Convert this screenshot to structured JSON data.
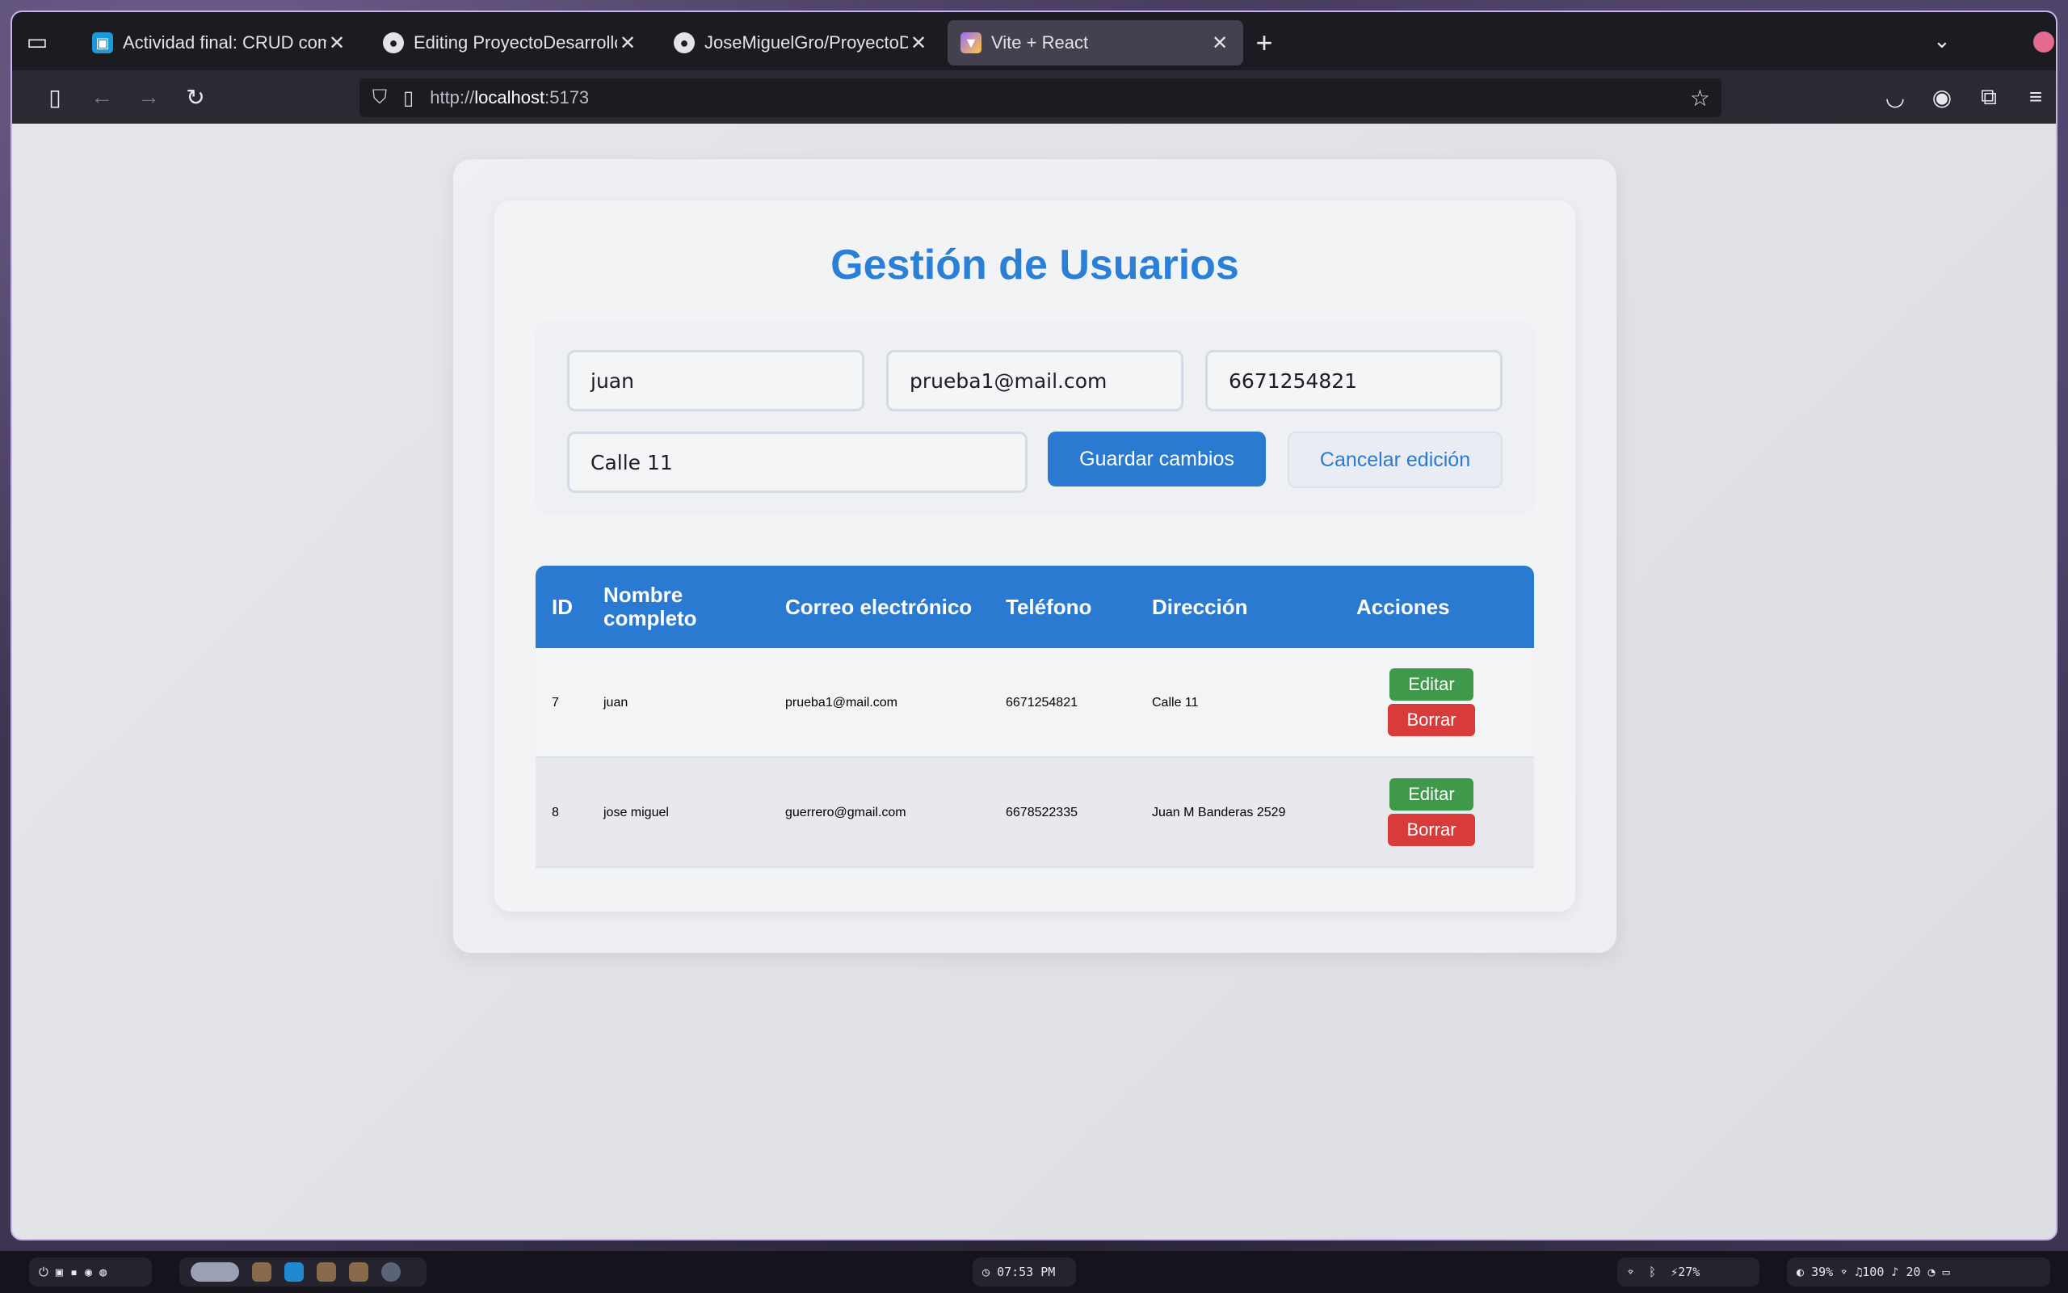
{
  "browser": {
    "tabs": [
      {
        "title": "Actividad final: CRUD compl",
        "favicon": "classroom-icon"
      },
      {
        "title": "Editing ProyectoDesarrolloV",
        "favicon": "github-icon"
      },
      {
        "title": "JoseMiguelGro/ProyectoDes",
        "favicon": "github-icon"
      },
      {
        "title": "Vite + React",
        "favicon": "vite-icon",
        "active": true
      }
    ],
    "url_scheme": "http://",
    "url_host": "localhost",
    "url_port": ":5173"
  },
  "page": {
    "title": "Gestión de Usuarios",
    "form": {
      "name_value": "juan",
      "email_value": "prueba1@mail.com",
      "phone_value": "6671254821",
      "address_value": "Calle 11",
      "save_label": "Guardar cambios",
      "cancel_label": "Cancelar edición"
    },
    "table": {
      "headers": [
        "ID",
        "Nombre completo",
        "Correo electrónico",
        "Teléfono",
        "Dirección",
        "Acciones"
      ],
      "rows": [
        {
          "id": "7",
          "name": "juan",
          "email": "prueba1@mail.com",
          "phone": "6671254821",
          "address": "Calle 11",
          "edit": "Editar",
          "delete": "Borrar"
        },
        {
          "id": "8",
          "name": "jose miguel",
          "email": "guerrero@gmail.com",
          "phone": "6678522335",
          "address": "Juan M Banderas 2529",
          "edit": "Editar",
          "delete": "Borrar"
        }
      ]
    },
    "colors": {
      "accent": "#2a7ad1",
      "edit": "#3e9a4a",
      "delete": "#d93b3b"
    }
  },
  "taskbar": {
    "clock": "07:53 PM",
    "battery": "27%",
    "brightness": "39%",
    "volume": "100",
    "mic": "20"
  }
}
